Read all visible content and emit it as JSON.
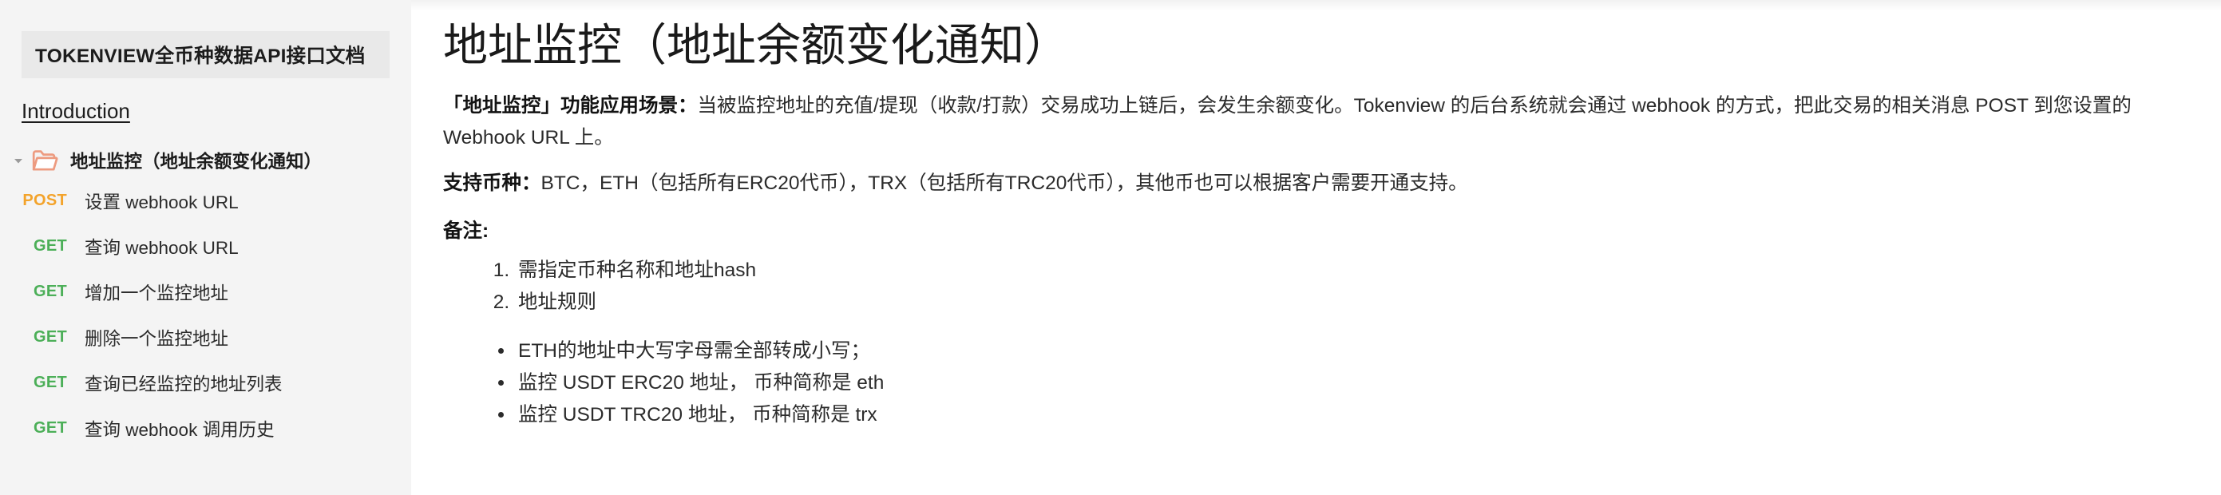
{
  "sidebar": {
    "product_title": "TOKENVIEW全币种数据API接口文档",
    "intro_link": "Introduction",
    "folder": {
      "label": "地址监控（地址余额变化通知）",
      "caret_icon": "chevron-down-icon",
      "folder_icon": "open-folder-icon",
      "expanded": true
    },
    "endpoints": [
      {
        "method": "POST",
        "label": "设置 webhook URL"
      },
      {
        "method": "GET",
        "label": "查询 webhook URL"
      },
      {
        "method": "GET",
        "label": "增加一个监控地址"
      },
      {
        "method": "GET",
        "label": "删除一个监控地址"
      },
      {
        "method": "GET",
        "label": "查询已经监控的地址列表"
      },
      {
        "method": "GET",
        "label": "查询 webhook 调用历史"
      }
    ]
  },
  "main": {
    "title": "地址监控（地址余额变化通知）",
    "scenario_label": "「地址监控」功能应用场景：",
    "scenario_body": "当被监控地址的充值/提现（收款/打款）交易成功上链后，会发生余额变化。Tokenview 的后台系统就会通过 webhook 的方式，把此交易的相关消息 POST 到您设置的Webhook URL 上。",
    "coins_label": "支持币种：",
    "coins_body": "BTC，ETH（包括所有ERC20代币），TRX（包括所有TRC20代币），其他币也可以根据客户需要开通支持。",
    "notes_label": "备注:",
    "notes_numbered": [
      "需指定币种名称和地址hash",
      "地址规则"
    ],
    "notes_bullets": [
      "ETH的地址中大写字母需全部转成小写；",
      "监控 USDT ERC20 地址， 币种简称是 eth",
      "监控 USDT TRC20 地址， 币种简称是 trx"
    ]
  },
  "colors": {
    "sidebar_bg": "#f4f4f4",
    "sidebar_title_bg": "#e9e9e9",
    "post_badge": "#f3a32b",
    "get_badge": "#4caf58",
    "folder_icon": "#ed9b80",
    "text": "#2b2b2b"
  }
}
